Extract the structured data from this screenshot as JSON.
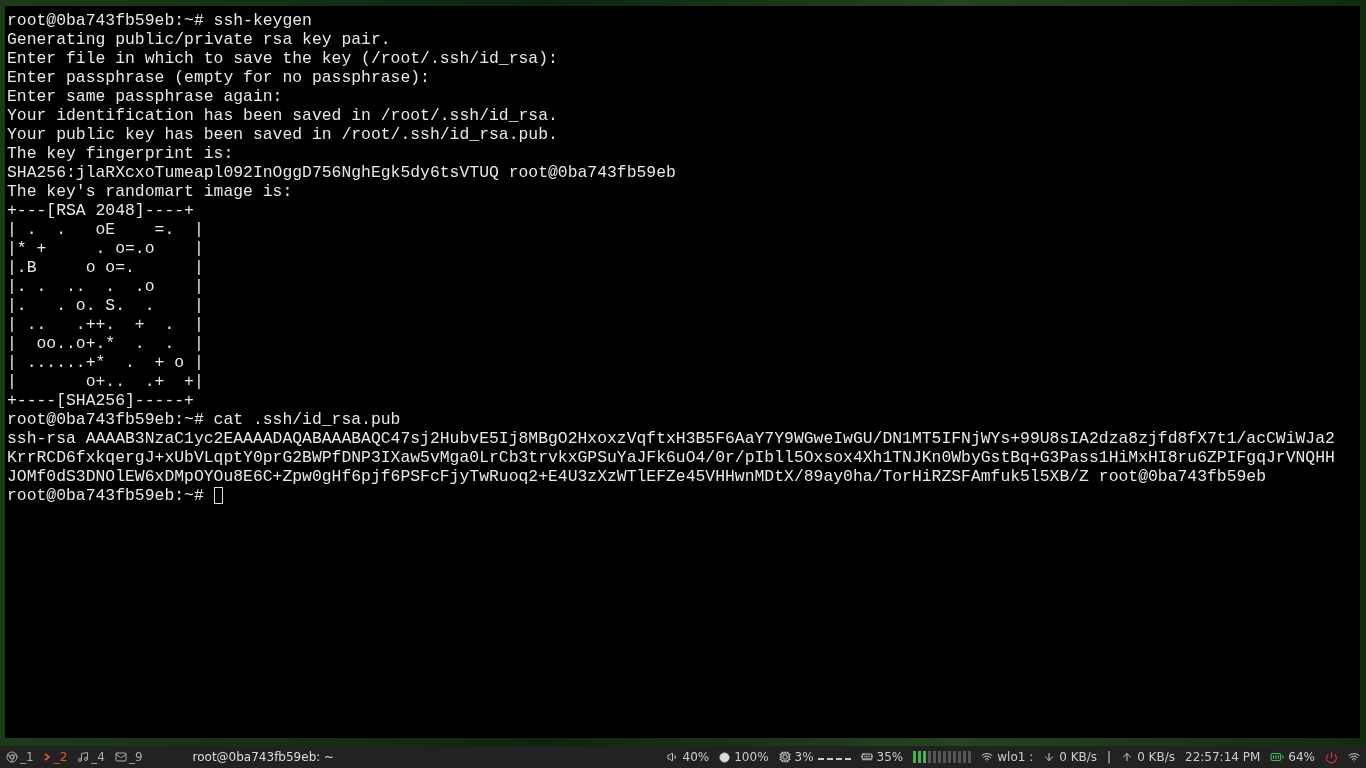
{
  "terminal": {
    "lines": [
      "root@0ba743fb59eb:~# ssh-keygen",
      "Generating public/private rsa key pair.",
      "Enter file in which to save the key (/root/.ssh/id_rsa):",
      "Enter passphrase (empty for no passphrase):",
      "Enter same passphrase again:",
      "Your identification has been saved in /root/.ssh/id_rsa.",
      "Your public key has been saved in /root/.ssh/id_rsa.pub.",
      "The key fingerprint is:",
      "SHA256:jlaRXcxoTumeapl092InOggD756NghEgk5dy6tsVTUQ root@0ba743fb59eb",
      "The key's randomart image is:",
      "+---[RSA 2048]----+",
      "| .  .   oE    =.  |",
      "|* +     . o=.o    |",
      "|.B     o o=.      |",
      "|. .  ..  .  .o    |",
      "|.   . o. S.  .    |",
      "| ..   .++.  +  .  |",
      "|  oo..o+.*  .  .  |",
      "| ......+*  .  + o |",
      "|       o+..  .+  +|",
      "+----[SHA256]-----+",
      "root@0ba743fb59eb:~# cat .ssh/id_rsa.pub",
      "ssh-rsa AAAAB3NzaC1yc2EAAAADAQABAAABAQC47sj2HubvE5Ij8MBgO2HxoxzVqftxH3B5F6AaY7Y9WGweIwGU/DN1MT5IFNjWYs+99U8sIA2dza8zjfd8fX7t1/acCWiWJa2",
      "KrrRCD6fxkqergJ+xUbVLqptY0prG2BWPfDNP3IXaw5vMga0LrCb3trvkxGPSuYaJFk6uO4/0r/pIbll5Oxsox4Xh1TNJKn0WbyGstBq+G3Pass1HiMxHI8ru6ZPIFgqJrVNQHH",
      "JOMf0dS3DNOlEW6xDMpOYOu8E6C+Zpw0gHf6pjf6PSFcFjyTwRuoq2+E4U3zXzWTlEFZe45VHHwnMDtX/89ay0ha/TorHiRZSFAmfuk5l5XB/Z root@0ba743fb59eb"
    ],
    "prompt": "root@0ba743fb59eb:~#"
  },
  "taskbar": {
    "workspaces": [
      {
        "kind": "browser",
        "label": "_1",
        "selected": false
      },
      {
        "kind": "terminal",
        "label": "_2",
        "selected": true
      },
      {
        "kind": "music",
        "label": "_4",
        "selected": false
      },
      {
        "kind": "mail",
        "label": "_9",
        "selected": false
      }
    ],
    "window_title": "root@0ba743fb59eb: ~",
    "volume": "40%",
    "brightness": "100%",
    "cpu": "3%",
    "ram": "35%",
    "meter": {
      "level": 0.25
    },
    "interface": "wlo1 :",
    "down": "0 KB/s",
    "separator": "|",
    "up": "0 KB/s",
    "clock": "22:57:14 PM",
    "battery": "64%"
  }
}
